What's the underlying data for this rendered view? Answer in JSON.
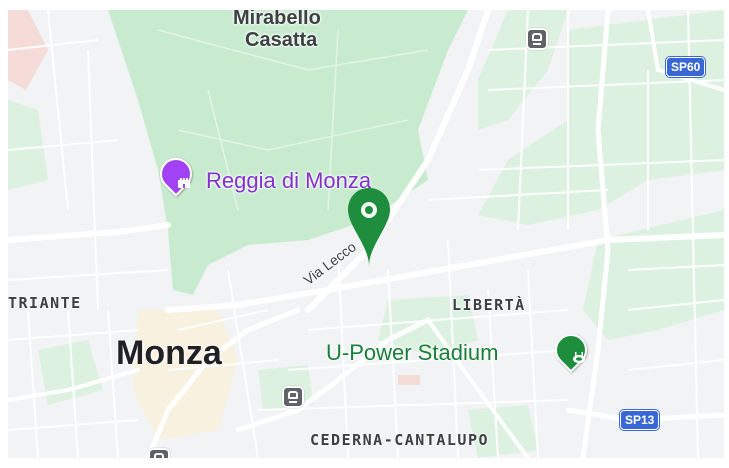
{
  "map": {
    "colors": {
      "park": "#c8ebcf",
      "park_light": "#ddf1e1",
      "urban": "#f1f3f4",
      "road": "#ffffff",
      "highway_shield": "#3968d4",
      "poi_purple": "#8430ce",
      "poi_green": "#1e8e3e",
      "pin_red": "#e8a69b"
    },
    "labels": {
      "park_name_line1": "Mirabello",
      "park_name_line2": "Casatta",
      "reggia": "Reggia di Monza",
      "street": "Via Lecco",
      "district_left": "TRIANTE",
      "district_liberta": "LIBERTÀ",
      "city": "Monza",
      "stadium": "U-Power Stadium",
      "district_cederna": "CEDERNA-CANTALUPO"
    },
    "shields": {
      "sp60": "SP60",
      "sp13": "SP13"
    },
    "icons": {
      "reggia_marker": "castle-icon",
      "stadium_marker": "stadium-icon",
      "location_pin": "map-pin-icon",
      "train_station": "train-icon"
    }
  }
}
